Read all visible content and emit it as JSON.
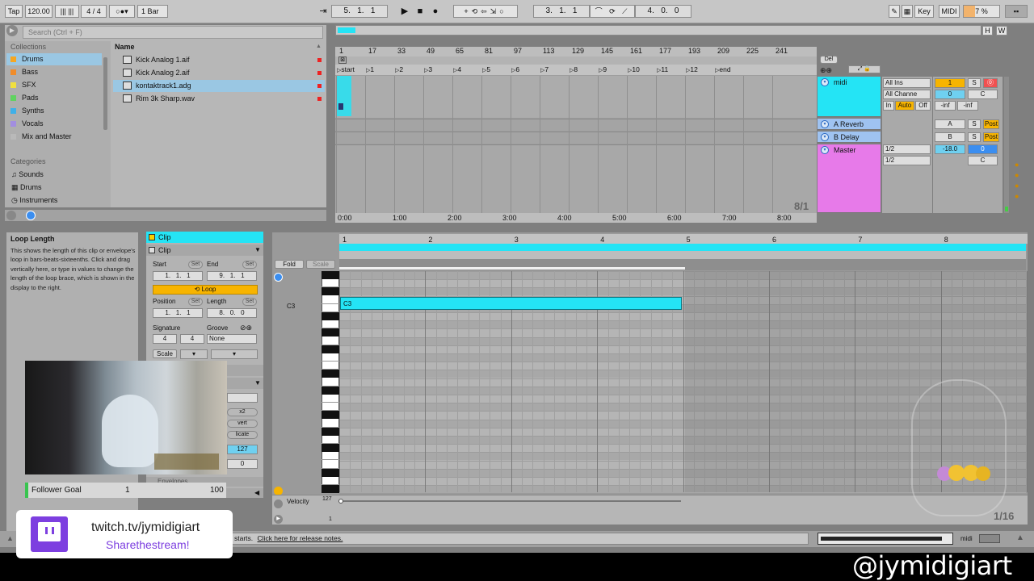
{
  "toolbar": {
    "tap": "Tap",
    "tempo": "120.00",
    "signature": "4 / 4",
    "quantize": "1 Bar",
    "arrangement_position": "5.   1.   1",
    "loop_start": "3.   1.   1",
    "loop_length": "4.   0.   0",
    "key_label": "Key",
    "midi_label": "MIDI",
    "cpu": "7 %",
    "h_label": "H",
    "w_label": "W"
  },
  "browser": {
    "search_placeholder": "Search (Ctrl + F)",
    "collections_title": "Collections",
    "collections": [
      {
        "label": "Drums",
        "color": "#f5a623",
        "selected": true
      },
      {
        "label": "Bass",
        "color": "#f08c2a",
        "selected": false
      },
      {
        "label": "SFX",
        "color": "#f0e040",
        "selected": false
      },
      {
        "label": "Pads",
        "color": "#5fd35f",
        "selected": false
      },
      {
        "label": "Synths",
        "color": "#3fb0e8",
        "selected": false
      },
      {
        "label": "Vocals",
        "color": "#a28ee0",
        "selected": false
      },
      {
        "label": "Mix and Master",
        "color": "#b9b9b9",
        "selected": false
      }
    ],
    "categories_title": "Categories",
    "categories": [
      "Sounds",
      "Drums",
      "Instruments"
    ],
    "name_header": "Name",
    "files": [
      "Kick Analog 1.aif",
      "Kick Analog 2.aif",
      "kontaktrack1.adg",
      "Rim 3k Sharp.wav"
    ]
  },
  "arrangement": {
    "bar_ticks": [
      "1",
      "17",
      "33",
      "49",
      "65",
      "81",
      "97",
      "113",
      "129",
      "145",
      "161",
      "177",
      "193",
      "209",
      "225",
      "241"
    ],
    "locators": [
      "start",
      "1",
      "2",
      "3",
      "4",
      "5",
      "6",
      "7",
      "8",
      "9",
      "10",
      "11",
      "12",
      "end"
    ],
    "time_ticks": [
      "0:00",
      "1:00",
      "2:00",
      "3:00",
      "4:00",
      "5:00",
      "6:00",
      "7:00",
      "8:00"
    ],
    "zoom": "8/1",
    "del_label": "Del"
  },
  "tracks": [
    {
      "name": "midi",
      "color": "#24e4f5"
    },
    {
      "name": "A Reverb",
      "color": "#9fc3f1"
    },
    {
      "name": "B Delay",
      "color": "#9fc3f1"
    },
    {
      "name": "Master",
      "color": "#e77ae9"
    }
  ],
  "mixer": {
    "midi_input": "All Ins",
    "midi_channel": "All Channe",
    "in_label": "In",
    "auto_label": "Auto",
    "off_label": "Off",
    "track_number": "1",
    "solo": "S",
    "volume": "0",
    "pan": "C",
    "inf_left": "-inf",
    "inf_right": "-inf",
    "return_a": "A",
    "return_b": "B",
    "post": "Post",
    "master_out1": "1/2",
    "master_out2": "1/2",
    "master_volume": "-18.0",
    "master_zero": "0",
    "master_pan": "C"
  },
  "info": {
    "title": "Loop Length",
    "text": "This shows the length of this clip or envelope's loop in bars-beats-sixteenths. Click and drag vertically here, or type in values to change the length of the loop brace, which is shown in the display to the right."
  },
  "clip": {
    "header": "Clip",
    "section": "Clip",
    "start_label": "Start",
    "end_label": "End",
    "set_label": "Set",
    "start": "1.   1.   1",
    "end": "9.   1.   1",
    "loop_label": "Loop",
    "position_label": "Position",
    "length_label": "Length",
    "position": "1.   1.   1",
    "length": "8.   0.   0",
    "signature_label": "Signature",
    "groove_label": "Groove",
    "sig_num": "4",
    "sig_den": "4",
    "groove": "None",
    "scale_label": "Scale",
    "partial": [
      "x2",
      "vert",
      "licate",
      "127",
      "0"
    ],
    "envelopes": "Envelopes"
  },
  "piano_roll": {
    "bar_ticks": [
      "1",
      "2",
      "3",
      "4",
      "5",
      "6",
      "7",
      "8"
    ],
    "fold": "Fold",
    "scale": "Scale",
    "note_label": "C3",
    "row_label": "C3",
    "velocity_label": "Velocity",
    "velocity_max": "127",
    "velocity_min": "1",
    "grid": "1/16"
  },
  "status": {
    "message": "starts.",
    "link": "Click here for release notes.",
    "midi_label": "midi"
  },
  "overlay": {
    "follower_goal": "Follower Goal",
    "goal_current": "1",
    "goal_target": "100",
    "twitch_url": "twitch.tv/jymidigiart",
    "twitch_tag": "Sharethestream!",
    "handle": "@jymidigiart"
  },
  "colors": {
    "clip_cyan": "#24e4f5",
    "loop_orange": "#f7b400",
    "master_pink": "#e77ae9",
    "return_blue": "#9fc3f1",
    "twitch_purple": "#7d3fe0"
  }
}
